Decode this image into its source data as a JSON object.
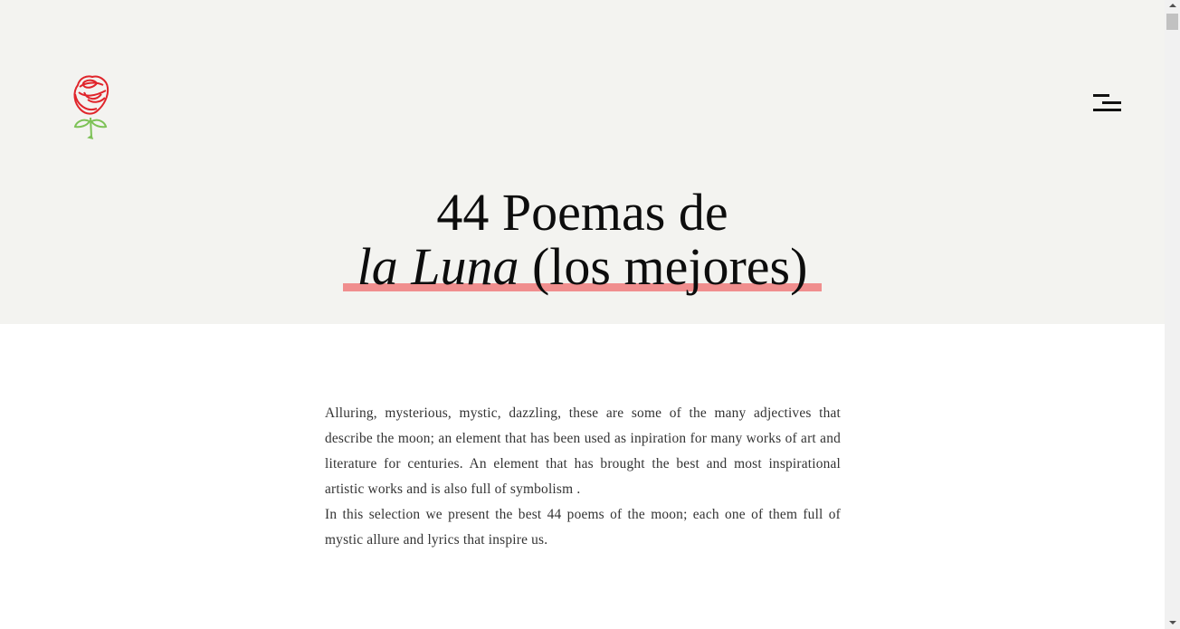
{
  "header": {
    "logo_icon": "rose-icon",
    "menu_icon": "hamburger-menu-icon"
  },
  "hero": {
    "title_line1": "44 Poemas de",
    "title_italic": "la Luna",
    "title_rest": " (los mejores)",
    "background_color": "#f3f3f0",
    "highlight_color": "#f08e8e"
  },
  "intro": {
    "paragraph1": "Alluring, mysterious, mystic, dazzling, these are some of the many adjectives that describe the moon; an element that has been used as inpiration for many works of art and literature for centuries. An element that has brought the best and most inspirational artistic works and is also full of symbolism .",
    "paragraph2": "In this selection we present the best 44 poems of the moon; each one of them full of mystic allure and lyrics that inspire us."
  },
  "scrollbar": {
    "scroll_position": 0
  }
}
